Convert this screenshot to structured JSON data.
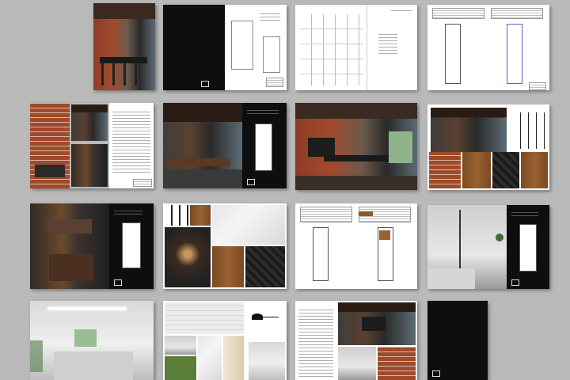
{
  "pages": [
    {
      "id": "p01-cover-photo"
    },
    {
      "id": "p02-black-intro"
    },
    {
      "id": "p03-perspective-sketch"
    },
    {
      "id": "p04-plans"
    },
    {
      "id": "p05-text-brick"
    },
    {
      "id": "p06-dark-render-plan"
    },
    {
      "id": "p07-kitchen-render"
    },
    {
      "id": "p08-materials"
    },
    {
      "id": "p09-bath-render"
    },
    {
      "id": "p10-materials-mood"
    },
    {
      "id": "p11-plan-table"
    },
    {
      "id": "p12-bedroom-render"
    },
    {
      "id": "p13-bedroom-photo"
    },
    {
      "id": "p14-materials-bedroom"
    },
    {
      "id": "p15-text-living"
    },
    {
      "id": "p16-back-cover"
    }
  ]
}
